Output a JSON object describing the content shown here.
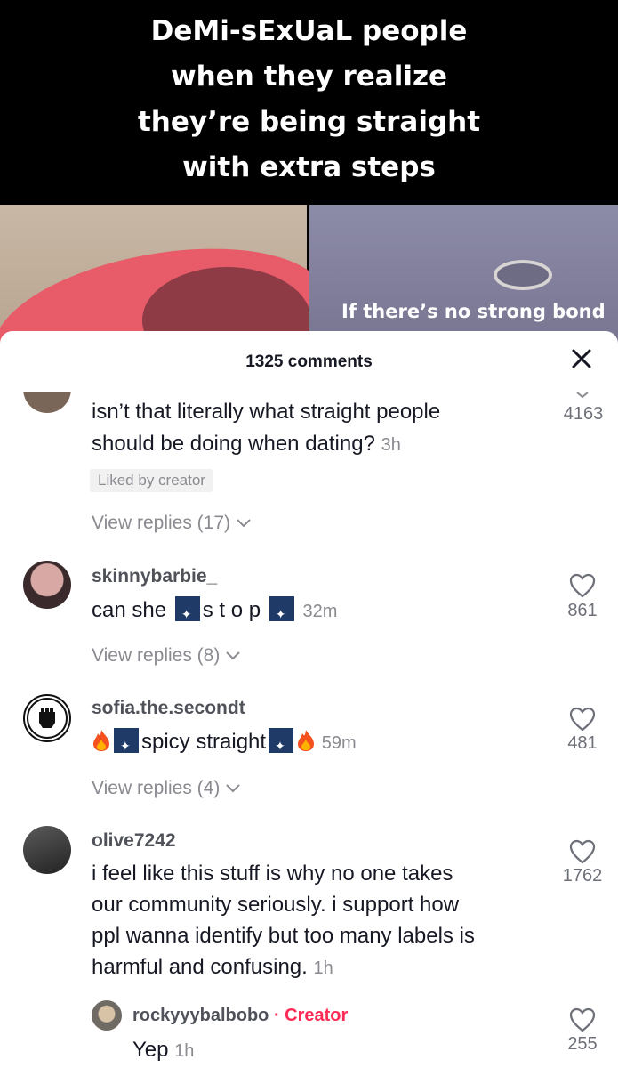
{
  "video": {
    "caption_lines": [
      "DeMi-sExUaL people",
      "when they realize",
      "they’re being straight",
      "with extra steps"
    ],
    "overlay_text": "If there’s no strong bond"
  },
  "sheet": {
    "title": "1325 comments"
  },
  "comments": [
    {
      "text_line1": "isn’t that literally what straight people",
      "text_line2": "should be doing when dating?",
      "time": "3h",
      "badge": "Liked by creator",
      "replies": "View replies (17)",
      "likes": "4163"
    },
    {
      "username": "skinnybarbie_",
      "text_a": "can she",
      "text_b": "s t o p",
      "time": "32m",
      "replies": "View replies (8)",
      "likes": "861"
    },
    {
      "username": "sofia.the.secondt",
      "text": "spicy straight",
      "time": "59m",
      "replies": "View replies (4)",
      "likes": "481"
    },
    {
      "username": "olive7242",
      "lines": [
        "i feel like this stuff is why no one takes",
        "our community seriously. i support how",
        "ppl wanna identify but too many labels is",
        "harmful and confusing."
      ],
      "time": "1h",
      "likes": "1762"
    }
  ],
  "reply": {
    "username": "rockyyybalbobo",
    "creator_label": "· Creator",
    "text": "Yep",
    "time": "1h",
    "likes": "255"
  },
  "icons": [
    "close-icon",
    "heart-icon",
    "chevron-down-icon",
    "fire-icon",
    "sparkle-emoji-icon",
    "raised-fist-icon"
  ],
  "colors": {
    "creator_accent": "#fe2c55",
    "text_primary": "#161823",
    "text_secondary": "#8a8b91"
  }
}
